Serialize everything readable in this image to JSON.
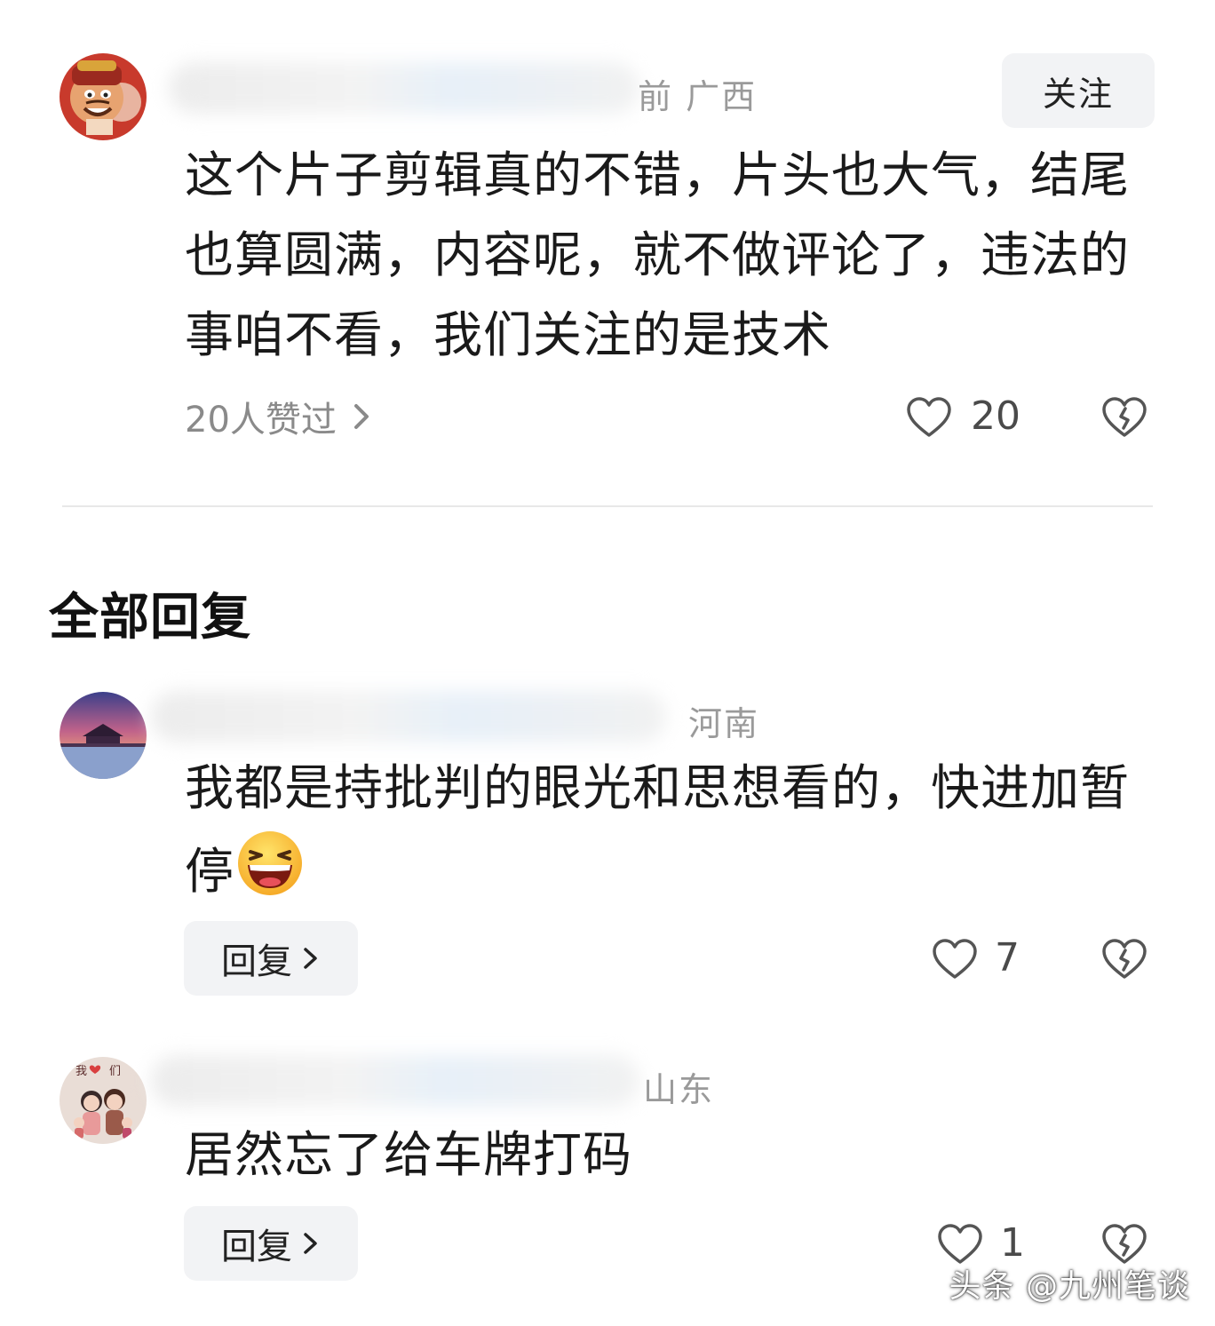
{
  "top_comment": {
    "meta": "前  广西",
    "follow_label": "关注",
    "text": "这个片子剪辑真的不错，片头也大气，结尾也算圆满，内容呢，就不做评论了，违法的事咱不看，我们关注的是技术",
    "liked_by": "20人赞过",
    "like_count": "20"
  },
  "section_title": "全部回复",
  "replies": [
    {
      "region": "河南",
      "text": "我都是持批判的眼光和思想看的，快进加暂停",
      "emoji": "laughing-emoji",
      "reply_label": "回复",
      "like_count": "7"
    },
    {
      "region": "山东",
      "text": "居然忘了给车牌打码",
      "reply_label": "回复",
      "like_count": "1"
    }
  ],
  "watermark": "头条 @九州笔谈",
  "colors": {
    "text": "#1a1a1a",
    "meta": "#9a9a9a",
    "button_bg": "#f2f3f5",
    "divider": "#e8e8e8"
  }
}
